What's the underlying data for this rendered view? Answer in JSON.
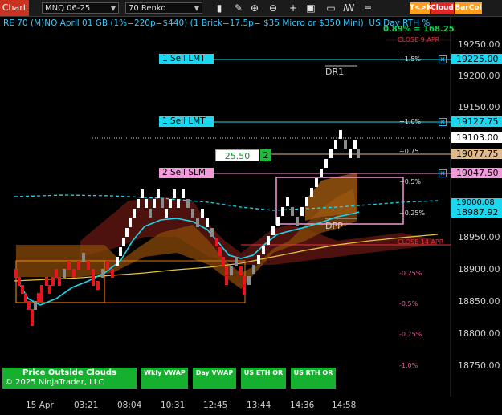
{
  "toolbar": {
    "title": "Chart",
    "instrument": "MNQ 06-25",
    "bar_type": "70 Renko",
    "icons": [
      "bar-style-icon",
      "draw-pencil-icon",
      "zoom-in-icon",
      "zoom-out-icon",
      "add-icon",
      "data-box-icon",
      "window-icon",
      "strategy-icon",
      "pin-icon"
    ],
    "btn_tk": "T<>K",
    "btn_cloud": "Cloud",
    "btn_barcol": "BarCol"
  },
  "chart_header": {
    "title": "RE 70 (M)NQ April 01 GB (1%=220p=$440) (1 Brick=17.5p= $35 Micro or $350 Mini), US Day RTH %",
    "stat": "0.89% = 168.25",
    "close_top": "CLOSE 9 APR",
    "close_mid": "CLOSE 14 APR"
  },
  "price_axis": {
    "labels": [
      "19250.00",
      "19200.00",
      "19150.00",
      "18950.00",
      "18900.00",
      "18850.00",
      "18800.00",
      "18750.00"
    ],
    "tags": [
      {
        "text": "19225.00",
        "bg": "#19d8f0",
        "fg": "#000"
      },
      {
        "text": "19127.75",
        "bg": "#19d8f0",
        "fg": "#000"
      },
      {
        "text": "19103.00",
        "bg": "#ffffff",
        "fg": "#000"
      },
      {
        "text": "19077.75",
        "bg": "#e0b98c",
        "fg": "#000"
      },
      {
        "text": "19047.50",
        "bg": "#f19ad9",
        "fg": "#000"
      },
      {
        "text": "19000.08",
        "bg": "#19d8f0",
        "fg": "#000"
      },
      {
        "text": "18987.92",
        "bg": "#19d8f0",
        "fg": "#000"
      }
    ]
  },
  "percent_levels": [
    "+1.5%",
    "+1.0%",
    "+0.75",
    "+0.5%",
    "+0.25%",
    "-0.25%",
    "-0.5%",
    "-0.75%",
    "-1.0%"
  ],
  "orders": {
    "sell_lmt_1": "1 Sell LMT",
    "sell_lmt_2": "1 Sell LMT",
    "sell_slm": "2 Sell SLM",
    "qty_value": "25.50",
    "qty_count": "2",
    "x": "✕"
  },
  "annotations": {
    "dr1": "DR1",
    "dpp": "DPP"
  },
  "time_axis": [
    "15 Apr",
    "03:21",
    "08:04",
    "10:31",
    "12:45",
    "13:44",
    "14:36",
    "14:58"
  ],
  "bottom_buttons": {
    "outside_clouds": "Price Outside Clouds",
    "copyright": "© 2025 NinjaTrader, LLC",
    "wkly_vwap": "Wkly VWAP",
    "day_vwap": "Day VWAP",
    "us_eth_or": "US ETH OR",
    "us_rth_or": "US RTH OR"
  },
  "colors": {
    "up_brick": "#ffffff",
    "down_brick": "#e8141e",
    "neutral_brick": "#8c8c8c",
    "cyan": "#19d8f0",
    "orange": "#e07a10",
    "pink": "#f19ad9",
    "green_btn": "#14b02e"
  }
}
